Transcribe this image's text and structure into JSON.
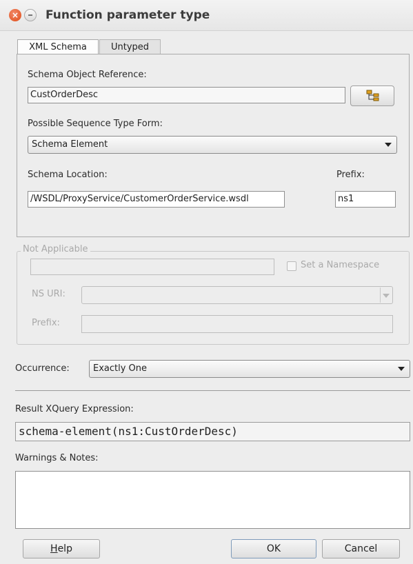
{
  "window": {
    "title": "Function parameter type",
    "close_glyph": "×"
  },
  "tabs": [
    {
      "label": "XML Schema"
    },
    {
      "label": "Untyped"
    }
  ],
  "xml_schema": {
    "schema_object_label": "Schema Object Reference:",
    "schema_object_value": "CustOrderDesc",
    "browse_icon": "schema-tree-icon",
    "sequence_label": "Possible Sequence Type Form:",
    "sequence_value": "Schema Element",
    "location_label": "Schema Location:",
    "location_value": "/WSDL/ProxyService/CustomerOrderService.wsdl",
    "prefix_label": "Prefix:",
    "prefix_value": "ns1"
  },
  "not_applicable": {
    "legend": "Not Applicable",
    "namespace_checkbox_label": "Set a Namespace",
    "ns_uri_label": "NS URI:",
    "prefix_label": "Prefix:"
  },
  "occurrence": {
    "label": "Occurrence:",
    "value": "Exactly One"
  },
  "result": {
    "label": "Result XQuery Expression:",
    "value": "schema-element(ns1:CustOrderDesc)"
  },
  "notes": {
    "label": "Warnings & Notes:",
    "value": ""
  },
  "buttons": {
    "help_mnemonic": "H",
    "help_rest": "elp",
    "ok": "OK",
    "cancel": "Cancel"
  },
  "colors": {
    "accent_close": "#df4b16",
    "background": "#ededed"
  }
}
